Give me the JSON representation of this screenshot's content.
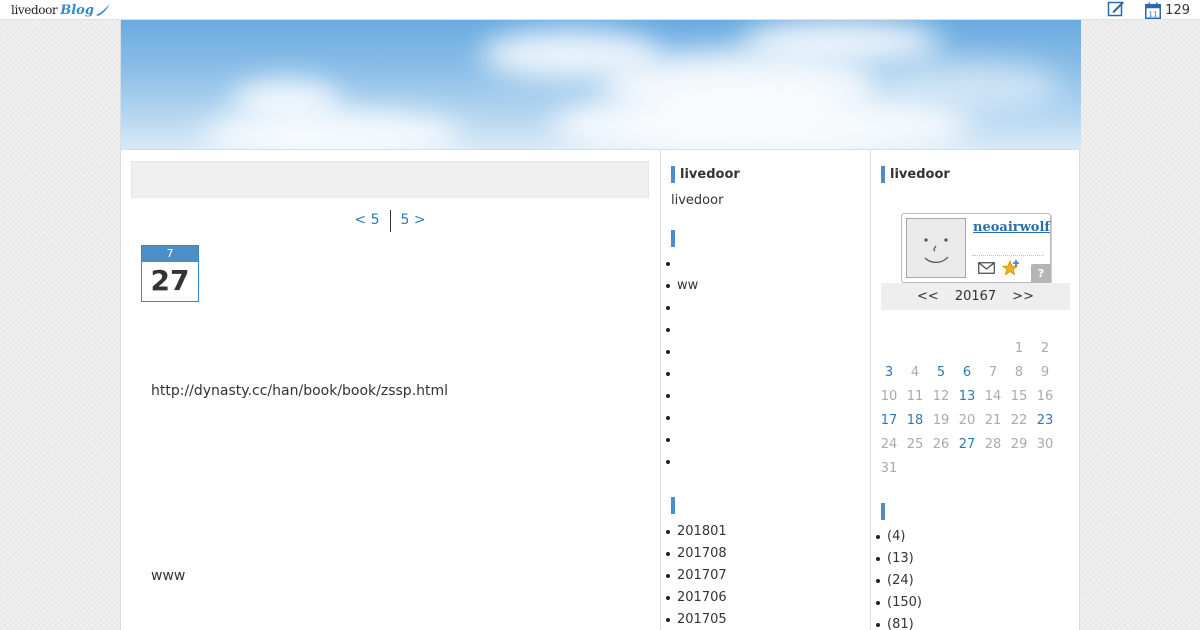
{
  "topbar": {
    "logo_text": "livedoor",
    "logo_blog": "Blog",
    "calendar_count": "129",
    "calendar_icon_day": "11"
  },
  "main": {
    "pager": {
      "prev": "< 5",
      "next": "5 >"
    },
    "date": {
      "month": "7",
      "day": "27"
    },
    "entry_url": "http://dynasty.cc/han/book/book/zssp.html",
    "entry_tail": "www"
  },
  "col2": {
    "title": "livedoor",
    "text": "livedoor",
    "list1": [
      "",
      "ww",
      "",
      "",
      "",
      "",
      "",
      "",
      "",
      ""
    ],
    "archives": [
      "201801",
      "201708",
      "201707",
      "201706",
      "201705"
    ]
  },
  "col3": {
    "title": "livedoor",
    "profile": {
      "name": "neoairwolf",
      "help_label": "?"
    },
    "calendar": {
      "prev": "<<",
      "month": "20167",
      "next": ">>",
      "leading_blanks": 5,
      "days": [
        "1",
        "2",
        "3",
        "4",
        "5",
        "6",
        "7",
        "8",
        "9",
        "10",
        "11",
        "12",
        "13",
        "14",
        "15",
        "16",
        "17",
        "18",
        "19",
        "20",
        "21",
        "22",
        "23",
        "24",
        "25",
        "26",
        "27",
        "28",
        "29",
        "30",
        "31"
      ],
      "linked_days": [
        "3",
        "5",
        "6",
        "13",
        "17",
        "18",
        "23",
        "27"
      ]
    },
    "categories": [
      "(4)",
      "(13)",
      "(24)",
      "(150)",
      "(81)"
    ]
  }
}
